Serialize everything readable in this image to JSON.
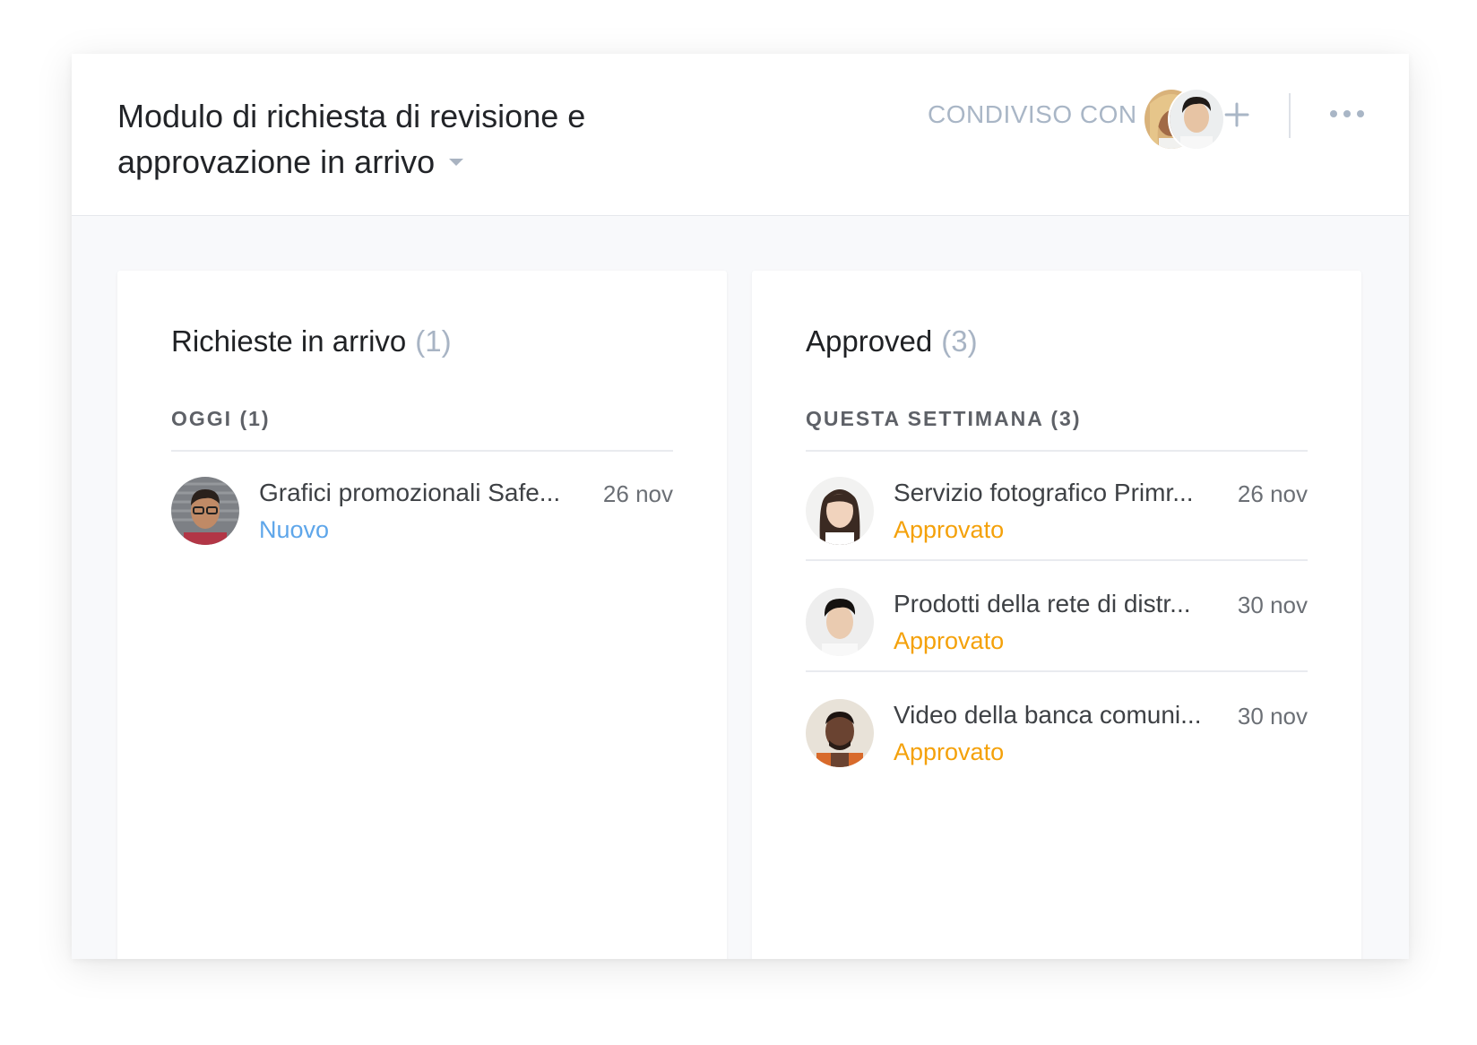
{
  "header": {
    "title": "Modulo di richiesta di revisione e approvazione in arrivo",
    "shared_label": "CONDIVISO CON",
    "shared_avatars": [
      "avatar-woman-blonde",
      "avatar-man-asian"
    ],
    "add_icon": "plus-icon",
    "more_icon": "more-dots-icon"
  },
  "columns": [
    {
      "title": "Richieste in arrivo",
      "count": "(1)",
      "section": "OGGI (1)",
      "items": [
        {
          "title": "Grafici promozionali Safe...",
          "date": "26 nov",
          "status": "Nuovo",
          "status_kind": "new"
        }
      ]
    },
    {
      "title": "Approved",
      "count": "(3)",
      "section": "QUESTA SETTIMANA (3)",
      "items": [
        {
          "title": "Servizio fotografico Primr...",
          "date": "26 nov",
          "status": "Approvato",
          "status_kind": "approved"
        },
        {
          "title": "Prodotti della rete di distr...",
          "date": "30 nov",
          "status": "Approvato",
          "status_kind": "approved"
        },
        {
          "title": "Video della banca comuni...",
          "date": "30 nov",
          "status": "Approvato",
          "status_kind": "approved"
        }
      ]
    }
  ],
  "colors": {
    "status_new": "#5ea6ea",
    "status_approved": "#f4a10a",
    "muted": "#a9b6c6"
  }
}
